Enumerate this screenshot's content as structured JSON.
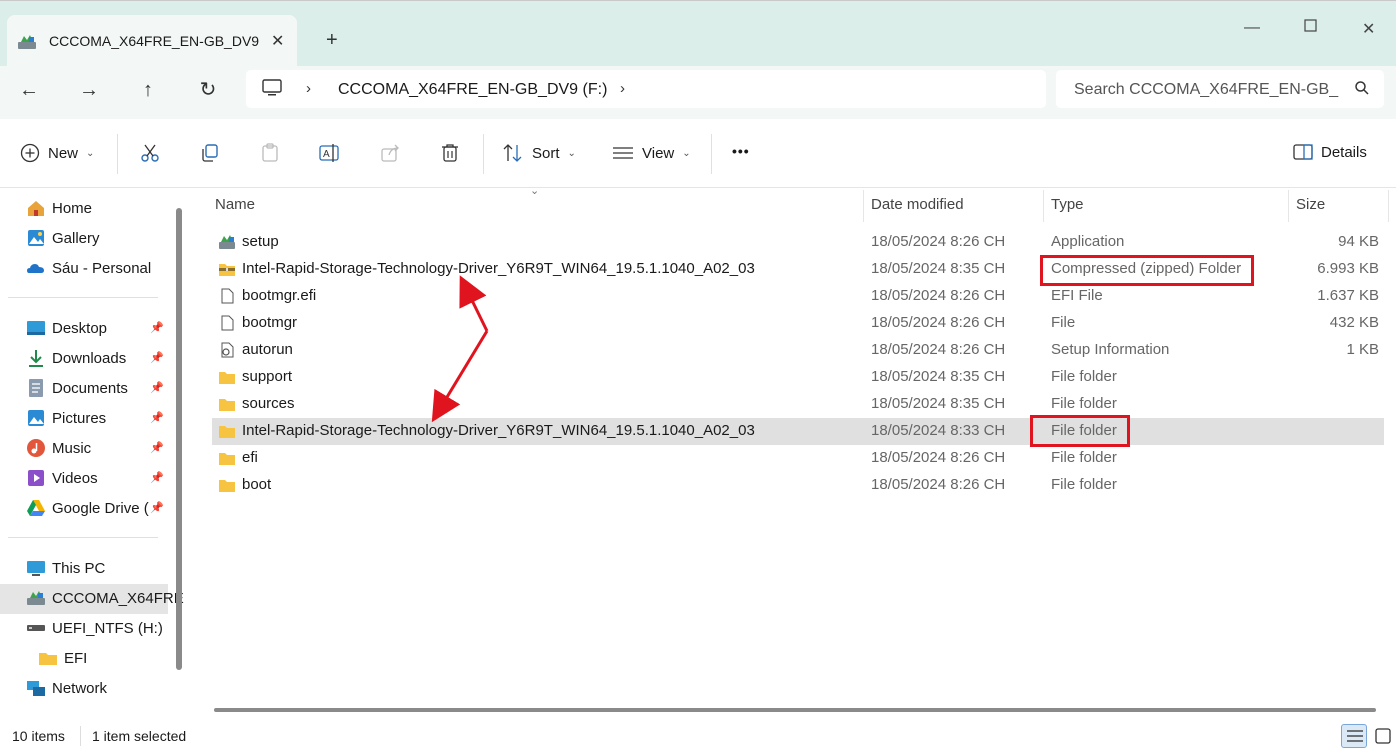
{
  "window": {
    "tab_title": "CCCOMA_X64FRE_EN-GB_DV9",
    "new_tab": "+"
  },
  "address": {
    "location": "CCCOMA_X64FRE_EN-GB_DV9 (F:)",
    "search_placeholder": "Search CCCOMA_X64FRE_EN-GB_"
  },
  "toolbar": {
    "new_label": "New",
    "sort_label": "Sort",
    "view_label": "View",
    "more_label": "•••",
    "details_label": "Details"
  },
  "sidebar": {
    "quick": [
      {
        "label": "Home",
        "icon": "home-icon"
      },
      {
        "label": "Gallery",
        "icon": "gallery-icon"
      },
      {
        "label": "Sáu - Personal",
        "icon": "onedrive-icon"
      }
    ],
    "pinned": [
      {
        "label": "Desktop",
        "icon": "desktop-icon"
      },
      {
        "label": "Downloads",
        "icon": "download-icon"
      },
      {
        "label": "Documents",
        "icon": "documents-icon"
      },
      {
        "label": "Pictures",
        "icon": "pictures-icon"
      },
      {
        "label": "Music",
        "icon": "music-icon"
      },
      {
        "label": "Videos",
        "icon": "videos-icon"
      },
      {
        "label": "Google Drive (",
        "icon": "google-drive-icon"
      }
    ],
    "devices": [
      {
        "label": "This PC",
        "icon": "this-pc-icon"
      },
      {
        "label": "CCCOMA_X64FRE",
        "icon": "dvd-drive-icon"
      },
      {
        "label": "UEFI_NTFS (H:)",
        "icon": "usb-drive-icon"
      },
      {
        "label": "EFI",
        "icon": "folder-icon"
      },
      {
        "label": "Network",
        "icon": "network-icon"
      }
    ]
  },
  "columns": {
    "name": "Name",
    "date": "Date modified",
    "type": "Type",
    "size": "Size"
  },
  "files": [
    {
      "name": "setup",
      "date": "18/05/2024 8:26 CH",
      "type": "Application",
      "size": "94 KB",
      "icon": "setup-icon"
    },
    {
      "name": "Intel-Rapid-Storage-Technology-Driver_Y6R9T_WIN64_19.5.1.1040_A02_03",
      "date": "18/05/2024 8:35 CH",
      "type": "Compressed (zipped) Folder",
      "size": "6.993 KB",
      "icon": "zip-folder-icon"
    },
    {
      "name": "bootmgr.efi",
      "date": "18/05/2024 8:26 CH",
      "type": "EFI File",
      "size": "1.637 KB",
      "icon": "file-icon"
    },
    {
      "name": "bootmgr",
      "date": "18/05/2024 8:26 CH",
      "type": "File",
      "size": "432 KB",
      "icon": "file-icon"
    },
    {
      "name": "autorun",
      "date": "18/05/2024 8:26 CH",
      "type": "Setup Information",
      "size": "1 KB",
      "icon": "setup-info-icon"
    },
    {
      "name": "support",
      "date": "18/05/2024 8:35 CH",
      "type": "File folder",
      "size": "",
      "icon": "folder-icon"
    },
    {
      "name": "sources",
      "date": "18/05/2024 8:35 CH",
      "type": "File folder",
      "size": "",
      "icon": "folder-icon"
    },
    {
      "name": "Intel-Rapid-Storage-Technology-Driver_Y6R9T_WIN64_19.5.1.1040_A02_03",
      "date": "18/05/2024 8:33 CH",
      "type": "File folder",
      "size": "",
      "icon": "folder-icon"
    },
    {
      "name": "efi",
      "date": "18/05/2024 8:26 CH",
      "type": "File folder",
      "size": "",
      "icon": "folder-icon"
    },
    {
      "name": "boot",
      "date": "18/05/2024 8:26 CH",
      "type": "File folder",
      "size": "",
      "icon": "folder-icon"
    }
  ],
  "status": {
    "item_count": "10 items",
    "selection": "1 item selected"
  },
  "colors": {
    "accent": "#0067c0",
    "annotation": "#e0141e",
    "titlebar": "#dceeea"
  }
}
